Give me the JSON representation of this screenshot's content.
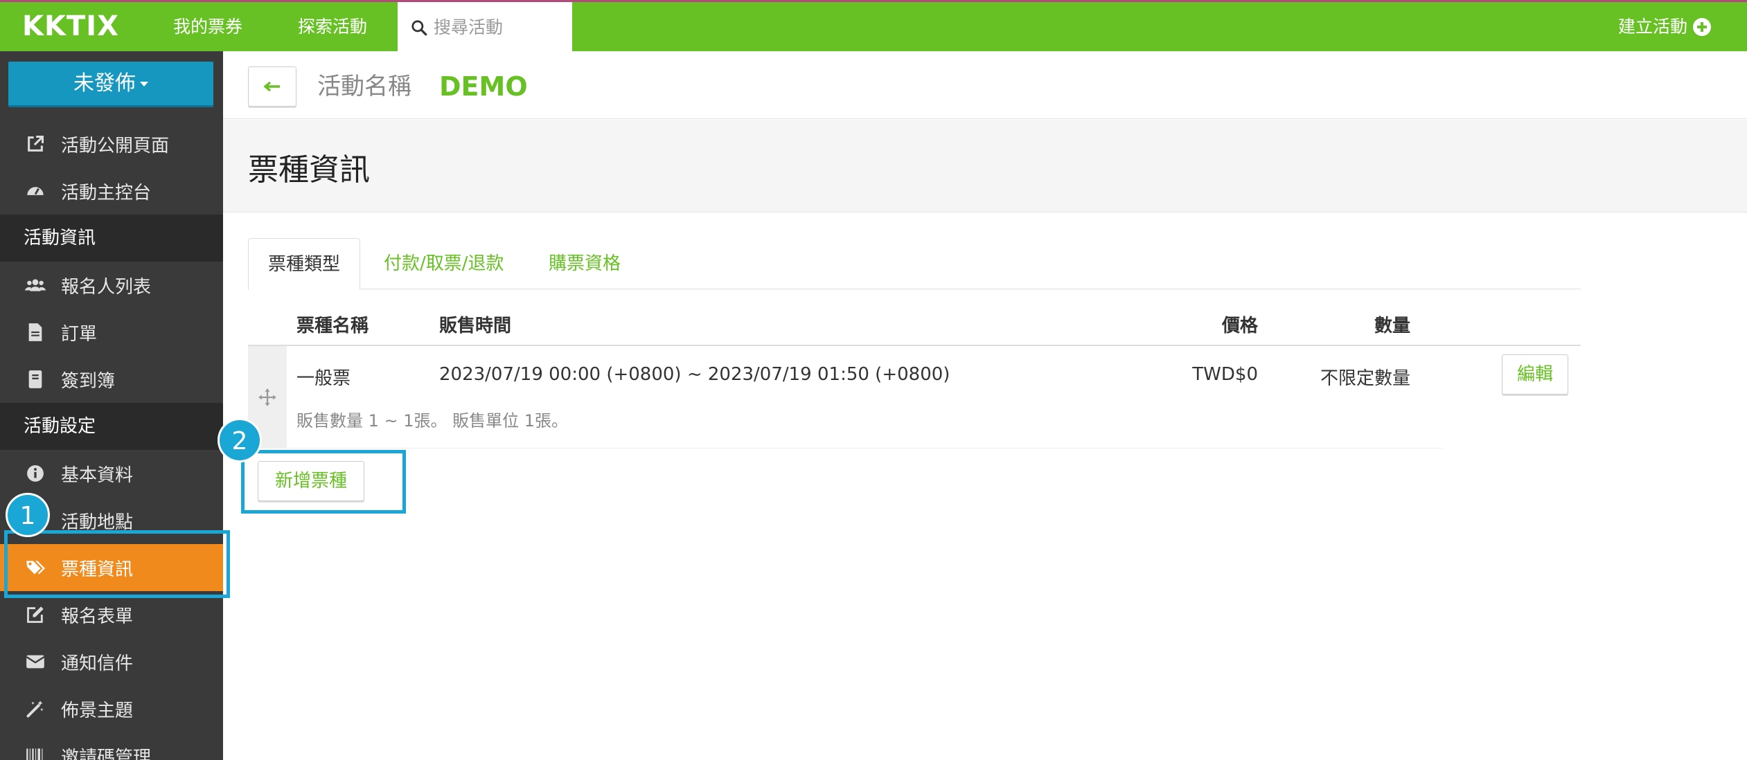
{
  "topbar": {
    "logo": "KKTIX",
    "my_tickets": "我的票券",
    "explore": "探索活動",
    "search_placeholder": "搜尋活動",
    "create_event": "建立活動"
  },
  "sidebar": {
    "publish_status": "未發佈",
    "items": [
      {
        "label": "活動公開頁面",
        "icon": "external-link-icon"
      },
      {
        "label": "活動主控台",
        "icon": "dashboard-icon"
      }
    ],
    "section_info": "活動資訊",
    "info_items": [
      {
        "label": "報名人列表",
        "icon": "users-icon"
      },
      {
        "label": "訂單",
        "icon": "file-icon"
      },
      {
        "label": "簽到簿",
        "icon": "book-icon"
      }
    ],
    "section_settings": "活動設定",
    "settings_items": [
      {
        "label": "基本資料",
        "icon": "info-icon"
      },
      {
        "label": "活動地點",
        "icon": "map-marker-icon"
      },
      {
        "label": "票種資訊",
        "icon": "tags-icon"
      },
      {
        "label": "報名表單",
        "icon": "edit-icon"
      },
      {
        "label": "通知信件",
        "icon": "envelope-icon"
      },
      {
        "label": "佈景主題",
        "icon": "magic-wand-icon"
      },
      {
        "label": "邀請碼管理",
        "icon": "barcode-icon"
      }
    ]
  },
  "annotations": {
    "badge_1": "1",
    "badge_2": "2"
  },
  "header": {
    "event_label": "活動名稱",
    "event_name": "DEMO"
  },
  "page": {
    "title": "票種資訊"
  },
  "tabs": [
    {
      "label": "票種類型"
    },
    {
      "label": "付款/取票/退款"
    },
    {
      "label": "購票資格"
    }
  ],
  "table": {
    "headers": {
      "name": "票種名稱",
      "time": "販售時間",
      "price": "價格",
      "qty": "數量"
    },
    "rows": [
      {
        "name": "一般票",
        "time": "2023/07/19 00:00 (+0800) ~ 2023/07/19 01:50 (+0800)",
        "price": "TWD$0",
        "qty": "不限定數量",
        "detail": "販售數量 1 ~ 1張。 販售單位 1張。",
        "edit_label": "編輯"
      }
    ]
  },
  "actions": {
    "add_ticket": "新增票種"
  },
  "colors": {
    "brand_green": "#67c124",
    "publish_blue": "#1597c0",
    "active_orange": "#f18a1c",
    "highlight_blue": "#1aa7d6",
    "sidebar_bg": "#3a3a3a"
  }
}
